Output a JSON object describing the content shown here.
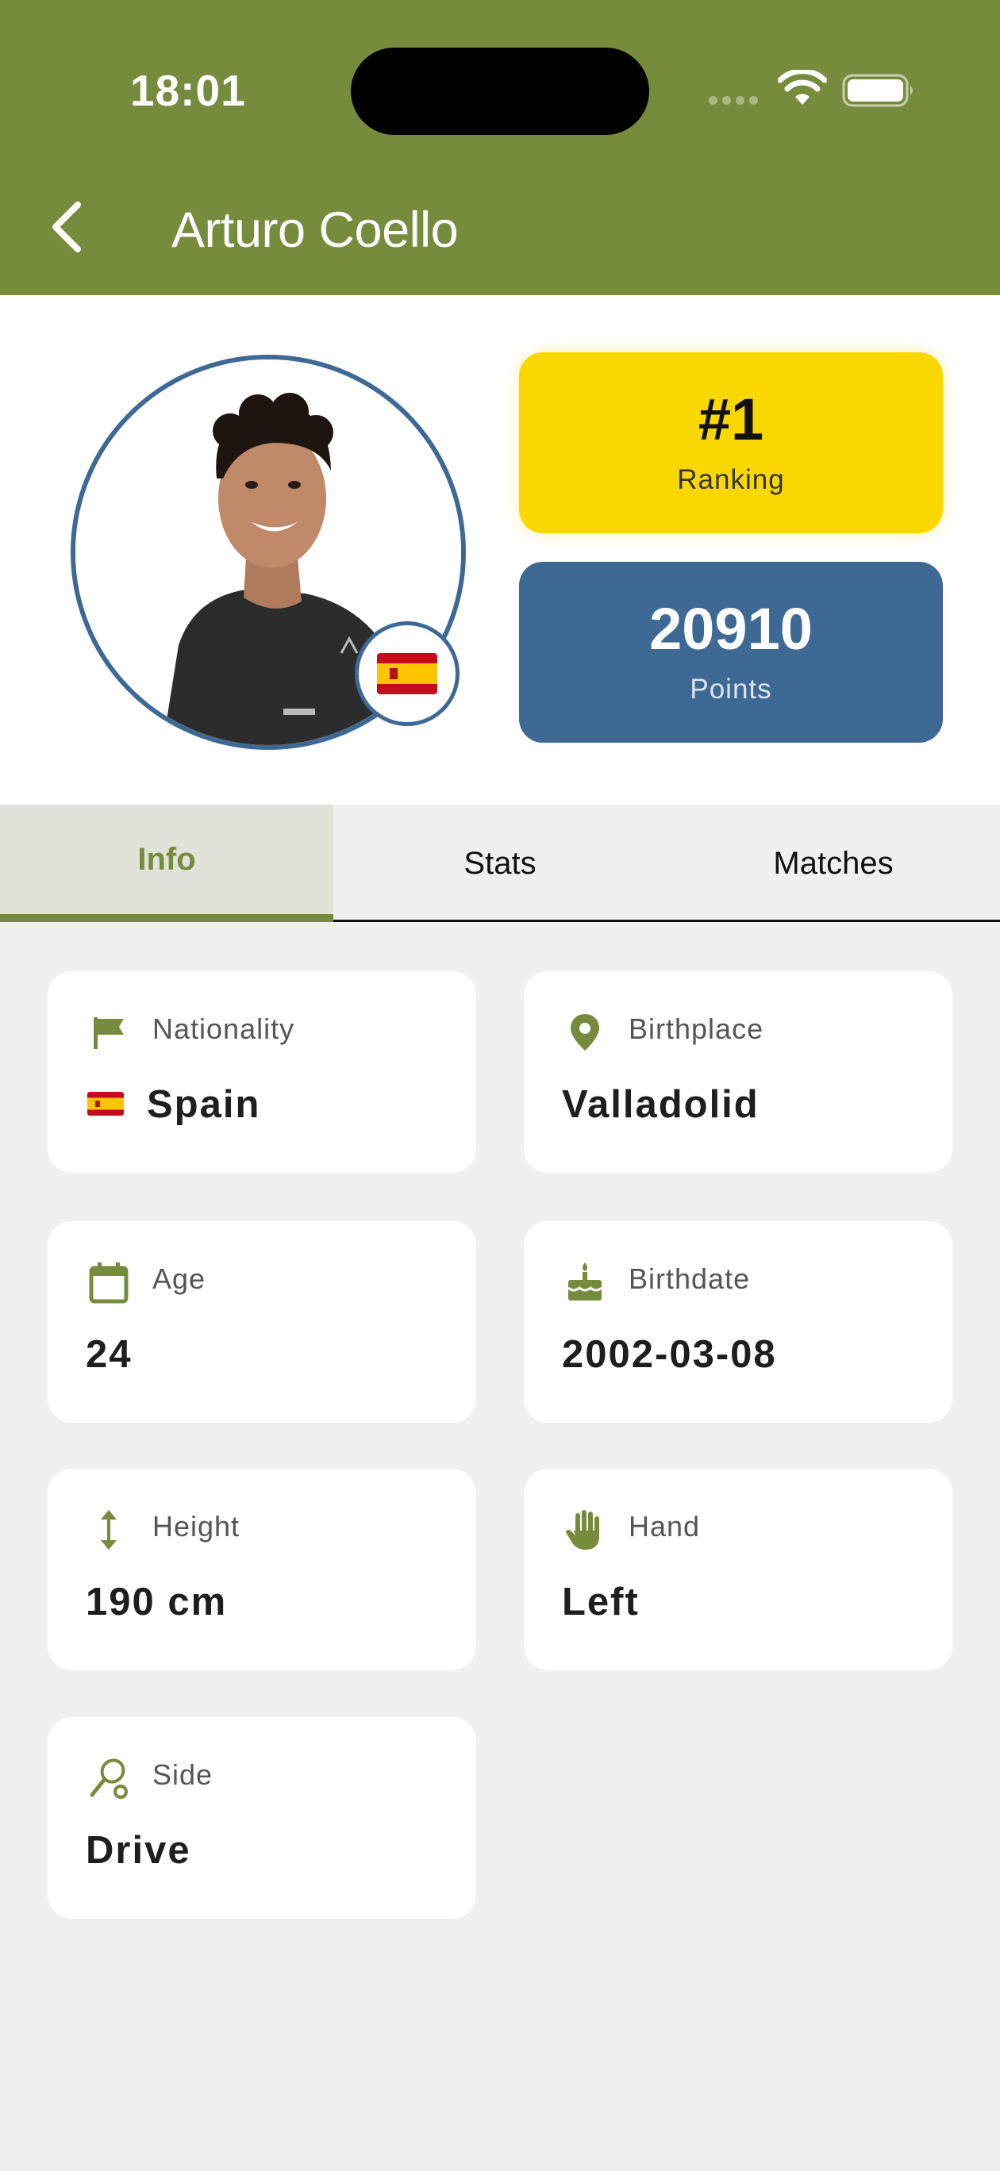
{
  "status_bar": {
    "time": "18:01"
  },
  "nav": {
    "title": "Arturo Coello"
  },
  "player": {
    "ranking_value": "#1",
    "ranking_label": "Ranking",
    "points_value": "20910",
    "points_label": "Points"
  },
  "tabs": [
    {
      "label": "Info",
      "active": true
    },
    {
      "label": "Stats",
      "active": false
    },
    {
      "label": "Matches",
      "active": false
    }
  ],
  "info": {
    "nationality": {
      "label": "Nationality",
      "value": "Spain",
      "icon": "flag-icon"
    },
    "birthplace": {
      "label": "Birthplace",
      "value": "Valladolid",
      "icon": "location-pin-icon"
    },
    "age": {
      "label": "Age",
      "value": "24",
      "icon": "calendar-icon"
    },
    "birthdate": {
      "label": "Birthdate",
      "value": "2002-03-08",
      "icon": "cake-icon"
    },
    "height": {
      "label": "Height",
      "value": "190 cm",
      "icon": "vertical-arrows-icon"
    },
    "hand": {
      "label": "Hand",
      "value": "Left",
      "icon": "hand-icon"
    },
    "side": {
      "label": "Side",
      "value": "Drive",
      "icon": "racket-icon"
    }
  },
  "colors": {
    "primary": "#778b3d",
    "ranking": "#fbd700",
    "points": "#3d6994",
    "background": "#f0f0f0"
  }
}
